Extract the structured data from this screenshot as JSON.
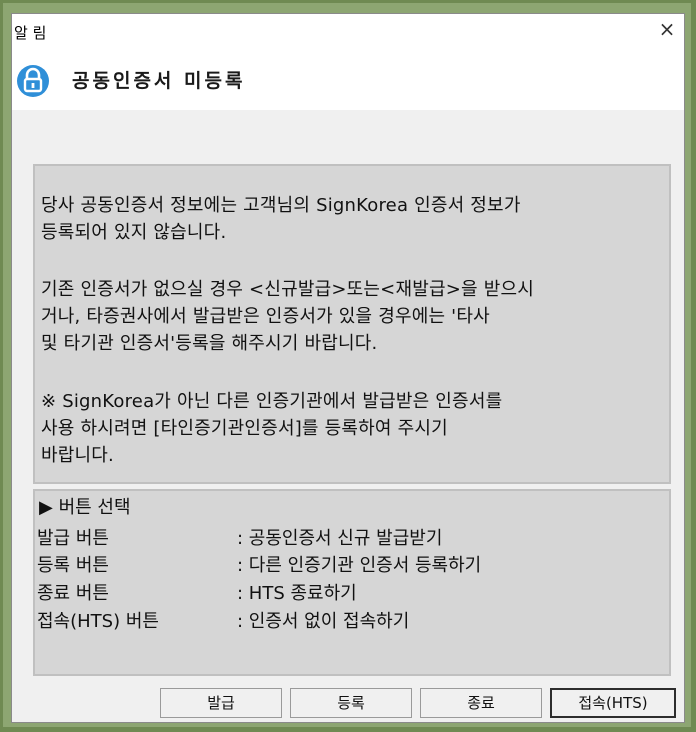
{
  "window": {
    "title": "알 림",
    "close_label": "×"
  },
  "header": {
    "title": "공동인증서 미등록"
  },
  "message": {
    "p1": "당사 공동인증서 정보에는 고객님의 SignKorea 인증서 정보가\n등록되어 있지 않습니다.",
    "p2": "기존 인증서가 없으실 경우 <신규발급>또는<재발급>을 받으시\n거나, 타증권사에서 발급받은 인증서가 있을 경우에는 '타사\n및 타기관 인증서'등록을 해주시기 바랍니다.",
    "p3": "※ SignKorea가 아닌 다른 인증기관에서 발급받은 인증서를\n  사용 하시려면 [타인증기관인증서]를 등록하여 주시기\n  바랍니다."
  },
  "info": {
    "title": "▶ 버튼 선택",
    "rows": [
      {
        "label": "발급 버튼",
        "desc": ": 공동인증서 신규 발급받기"
      },
      {
        "label": "등록 버튼",
        "desc": ": 다른 인증기관 인증서 등록하기"
      },
      {
        "label": "종료 버튼",
        "desc": ": HTS 종료하기"
      },
      {
        "label": "접속(HTS) 버튼",
        "desc": ": 인증서 없이 접속하기"
      }
    ]
  },
  "buttons": {
    "issue": "발급",
    "register": "등록",
    "exit": "종료",
    "connect": "접속(HTS)"
  },
  "colors": {
    "accent": "#2f8fd8",
    "panel": "#d6d6d6",
    "background": "#6f8a52"
  }
}
